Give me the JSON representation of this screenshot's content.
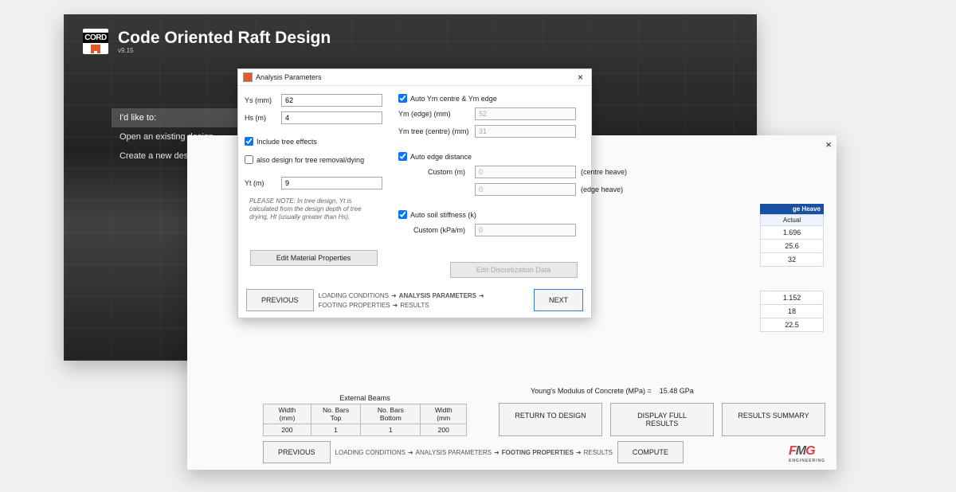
{
  "app": {
    "title": "Code Oriented Raft Design",
    "version": "v9.15",
    "logo_text": "CORD"
  },
  "sidebar": {
    "header": "I'd like to:",
    "items": [
      "Open an existing design",
      "Create a new design"
    ]
  },
  "dialog": {
    "title": "Analysis Parameters",
    "ys_label": "Ys (mm)",
    "ys_value": "62",
    "hs_label": "Hs (m)",
    "hs_value": "4",
    "include_tree": "Include tree effects",
    "also_design": "also design for tree removal/dying",
    "yt_label": "Yt (m)",
    "yt_value": "9",
    "note": "PLEASE NOTE: In tree design, Yt is calculated from the design depth of tree drying, Ht (usually greater than Hs).",
    "edit_material": "Edit Material Properties",
    "auto_ym": "Auto Ym centre & Ym edge",
    "ym_edge_label": "Ym (edge) (mm)",
    "ym_edge_value": "52",
    "ym_tree_label": "Ym tree (centre) (mm)",
    "ym_tree_value": "31",
    "auto_edge": "Auto edge distance",
    "custom_m_label": "Custom (m)",
    "custom_m1": "0",
    "custom_m1_suffix": "(centre heave)",
    "custom_m2": "0",
    "custom_m2_suffix": "(edge heave)",
    "auto_soil": "Auto soil stiffness (k)",
    "custom_kpa_label": "Custom (kPa/m)",
    "custom_kpa": "0",
    "edit_disc": "Edit Discretization Data",
    "prev": "PREVIOUS",
    "next": "NEXT",
    "bc": [
      "LOADING CONDITIONS",
      "ANALYSIS PARAMETERS",
      "FOOTING PROPERTIES",
      "RESULTS"
    ]
  },
  "win2": {
    "right_header": "ge Heave",
    "right_sub": "Actual",
    "right_vals": [
      "1.696",
      "25.6",
      "32",
      "",
      "1.152",
      "18",
      "22.5"
    ],
    "ext_header": "External Beams",
    "ext_cols": [
      "Width (mm)",
      "No. Bars Top",
      "No. Bars Bottom",
      "Width (mm"
    ],
    "ext_row": [
      "200",
      "1",
      "1",
      "200"
    ],
    "ym_label": "Young's Modulus of Concrete (MPa) =",
    "ym_value": "15.48 GPa",
    "btn_return": "RETURN TO DESIGN",
    "btn_display": "DISPLAY FULL RESULTS",
    "btn_summary": "RESULTS SUMMARY",
    "prev": "PREVIOUS",
    "compute": "COMPUTE",
    "bc": [
      "LOADING CONDITIONS",
      "ANALYSIS PARAMETERS",
      "FOOTING PROPERTIES",
      "RESULTS"
    ]
  },
  "fmg": "FMG"
}
